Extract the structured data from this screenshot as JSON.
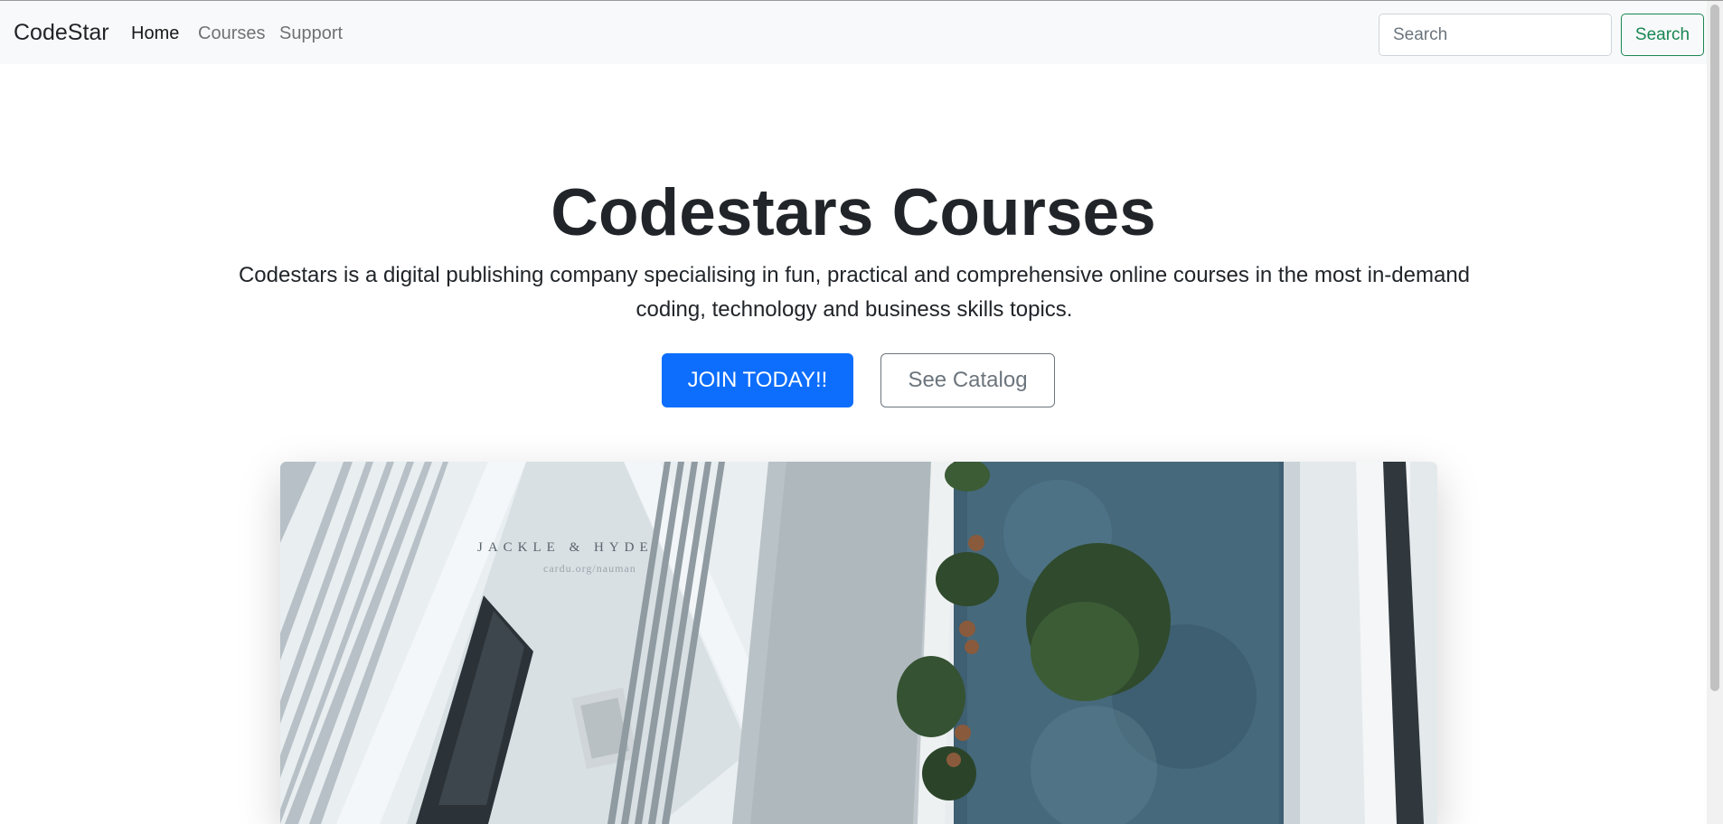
{
  "navbar": {
    "brand": "CodeStar",
    "links": [
      {
        "label": "Home",
        "active": true
      },
      {
        "label": "Courses",
        "active": false
      },
      {
        "label": "Support",
        "active": false
      }
    ],
    "search_placeholder": "Search",
    "search_button": "Search"
  },
  "hero": {
    "title": "Codestars Courses",
    "lead": "Codestars is a digital publishing company specialising in fun, practical and comprehensive online courses in the most in-demand coding, technology and business skills topics.",
    "primary_button": "JOIN TODAY!!",
    "secondary_button": "See Catalog",
    "image_watermark": {
      "title": "JACKLE & HYDE",
      "subtitle": "cardu.org/nauman"
    }
  },
  "colors": {
    "primary": "#0d6efd",
    "success": "#198754",
    "secondary": "#6c757d",
    "navbar_bg": "#f8f9fa"
  }
}
